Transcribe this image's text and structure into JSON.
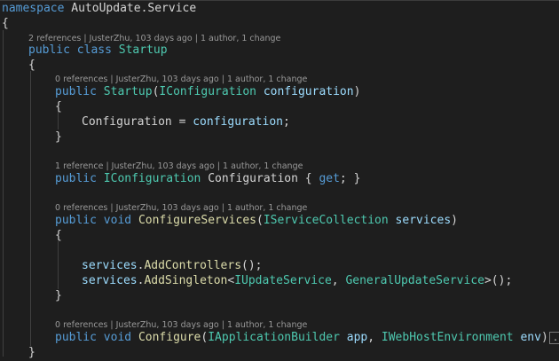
{
  "code": {
    "namespace_kw": "namespace",
    "namespace_a": "AutoUpdate",
    "namespace_dot": ".",
    "namespace_b": "Service",
    "open_ns": "{",
    "class_lens": "2 references | JusterZhu, 103 days ago | 1 author, 1 change",
    "class_public": "public",
    "class_kw": "class",
    "class_name": "Startup",
    "open_class": "{",
    "ctor_lens": "0 references | JusterZhu, 103 days ago | 1 author, 1 change",
    "ctor_public": "public",
    "ctor_name": "Startup",
    "ctor_paren_open": "(",
    "ctor_param_type": "IConfiguration",
    "ctor_param_name": "configuration",
    "ctor_paren_close": ")",
    "ctor_open": "{",
    "assign_left": "Configuration",
    "assign_eq": " = ",
    "assign_right": "configuration",
    "assign_semi": ";",
    "ctor_close": "}",
    "prop_lens": "1 reference | JusterZhu, 103 days ago | 1 author, 1 change",
    "prop_public": "public",
    "prop_type": "IConfiguration",
    "prop_name": "Configuration",
    "prop_open": " { ",
    "prop_get": "get",
    "prop_close": "; }",
    "cs_lens": "0 references | JusterZhu, 103 days ago | 1 author, 1 change",
    "cs_public": "public",
    "cs_void": "void",
    "cs_name": "ConfigureServices",
    "cs_paren_open": "(",
    "cs_param_type": "IServiceCollection",
    "cs_param_name": "services",
    "cs_paren_close": ")",
    "cs_open": "{",
    "l1_obj": "services",
    "l1_dot": ".",
    "l1_method": "AddControllers",
    "l1_end": "();",
    "l2_obj": "services",
    "l2_dot": ".",
    "l2_method": "AddSingleton",
    "l2_lt": "<",
    "l2_t1": "IUpdateService",
    "l2_comma": ", ",
    "l2_t2": "GeneralUpdateService",
    "l2_end": ">();",
    "cs_close": "}",
    "cf_lens": "0 references | JusterZhu, 103 days ago | 1 author, 1 change",
    "cf_public": "public",
    "cf_void": "void",
    "cf_name": "Configure",
    "cf_paren_open": "(",
    "cf_p1_type": "IApplicationBuilder",
    "cf_p1_name": "app",
    "cf_comma": ", ",
    "cf_p2_type": "IWebHostEnvironment",
    "cf_p2_name": "env",
    "cf_paren_close": ")",
    "cf_collapsed": "...",
    "close_class": "}"
  },
  "colors": {
    "background": "#1e1e1e",
    "keyword": "#569cd6",
    "type": "#4ec9b0",
    "method": "#dcdcaa",
    "identifier": "#9cdcfe",
    "plain": "#d4d4d4",
    "codelens": "#999999"
  }
}
